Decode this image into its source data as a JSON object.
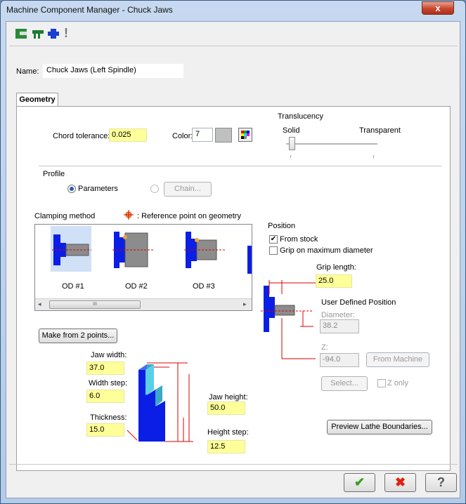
{
  "window": {
    "title": "Machine Component Manager - Chuck Jaws",
    "close_glyph": "x"
  },
  "toolbar": {
    "icons": [
      "jaw-profile-icon",
      "jaw-open-icon",
      "gripper-icon",
      "warning-icon"
    ],
    "warning_glyph": "!"
  },
  "name": {
    "label": "Name:",
    "value": "Chuck Jaws (Left Spindle)"
  },
  "tab": {
    "label": "Geometry"
  },
  "chord_tolerance": {
    "label": "Chord tolerance:",
    "value": "0.025"
  },
  "color": {
    "label": "Color:",
    "value": "7"
  },
  "translucency": {
    "label": "Translucency",
    "solid": "Solid",
    "transparent": "Transparent",
    "level": 0.0
  },
  "profile": {
    "label": "Profile",
    "parameters": "Parameters",
    "chain": "Chain..."
  },
  "clamping": {
    "label": "Clamping method",
    "reference_note": ": Reference point on geometry",
    "items": [
      "OD #1",
      "OD #2",
      "OD #3"
    ],
    "scroll_glyph": "III"
  },
  "position": {
    "label": "Position",
    "from_stock": "From stock",
    "grip_max": "Grip on maximum diameter",
    "grip_length_label": "Grip length:",
    "grip_length": "25.0",
    "user_defined": "User Defined Position",
    "diameter_label": "Diameter:",
    "diameter": "38.2",
    "z_label": "Z:",
    "z": "-94.0",
    "from_machine": "From Machine",
    "select": "Select...",
    "z_only": "Z only"
  },
  "make_from_points": "Make from 2 points...",
  "jaw": {
    "width_label": "Jaw width:",
    "width": "37.0",
    "width_step_label": "Width step:",
    "width_step": "6.0",
    "thickness_label": "Thickness:",
    "thickness": "15.0",
    "height_label": "Jaw height:",
    "height": "50.0",
    "height_step_label": "Height step:",
    "height_step": "12.5"
  },
  "preview_button": "Preview Lathe Boundaries...",
  "footer": {
    "ok": "✔",
    "cancel": "✖",
    "help": "?"
  },
  "colors": {
    "jaw_blue": "#0a1ee6",
    "stock_gray": "#8c8c8c",
    "field_yellow": "#ffff99",
    "dim_red": "#e60000"
  }
}
